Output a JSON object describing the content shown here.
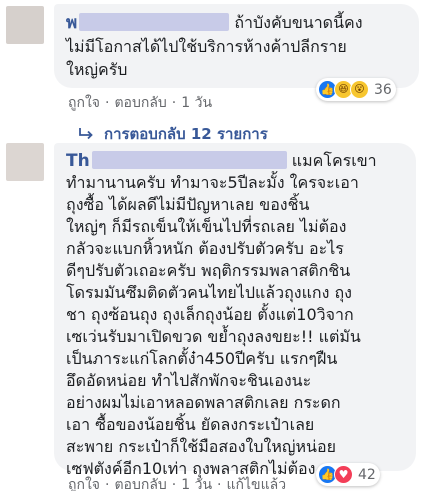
{
  "comment1": {
    "author_visible": "พ",
    "text": "ถ้าบังคับขนาดนี้คง\nไม่มีโอกาสได้ไปใช้บริการห้างค้าปลีกราย\nใหญ่ครับ",
    "reaction_count": "36",
    "actions": {
      "like": "ถูกใจ",
      "reply": "ตอบกลับ",
      "time": "1 วัน"
    }
  },
  "replies_link": "การตอบกลับ 12 รายการ",
  "comment2": {
    "author_visible": "Th",
    "text": "แมคโครเขา\nทำมานานครับ ทำมาจะ5ปีละมั้ง ใครจะเอา\nถุงซื้อ ได้ผลดีไม่มีปัญหาเลย ของชิ้น\nใหญ่ๆ ก็มีรถเข็นให้เข็นไปที่รถเลย ไม่ต้อง\nกลัวจะแบกหิ้วหนัก ต้องปรับตัวครับ อะไร\nดีๆปรับตัวเถอะครับ พฤติกรรมพลาสติกชิน\nโดรมมันซึมติดตัวคนไทยไปแล้วถุงแกง ถุง\nชา ถุงซ้อนถุง ถุงเล็กถุงน้อย ตั้งแต่10วิจาก\nเซเว่นรับมาเปิดขวด ขย้ำถุงลงขยะ!! แต่มัน\nเป็นภาระแก่โลกตั้ง๋า450ปีครับ แรกๆฝืน\nอึดอัดหน่อย ทำไปสักพักจะชินเองนะ\nอย่างผมไม่เอาหลอดพลาสติกเลย กระดก\nเอา ซื้อของน้อยชิ้น ยัดลงกระเป๋าเลย\nสะพาย กระเป๋าก็ใช้มือสองใบใหญ่หน่อย\nเซฟตังค์อีก10เท่า ถุงพลาสติกไม่ต้อง",
    "reaction_count": "42",
    "actions": {
      "like": "ถูกใจ",
      "reply": "ตอบกลับ",
      "time": "1 วัน",
      "edited": "แก้ไขแล้ว"
    }
  },
  "separator": "·",
  "colors": {
    "bubble": "#f2f3f5",
    "link_blue": "#385898",
    "like_blue": "#1877f2",
    "meta_gray": "#65676b"
  }
}
